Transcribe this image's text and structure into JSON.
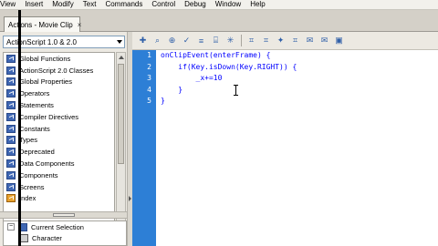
{
  "menubar": {
    "items": [
      "View",
      "Insert",
      "Modify",
      "Text",
      "Commands",
      "Control",
      "Debug",
      "Window",
      "Help"
    ]
  },
  "tab": {
    "label": "Actions - Movie Clip",
    "close": "×"
  },
  "language_select": {
    "value": "ActionScript 1.0 & 2.0"
  },
  "toolbox": {
    "items": [
      "Global Functions",
      "ActionScript 2.0 Classes",
      "Global Properties",
      "Operators",
      "Statements",
      "Compiler Directives",
      "Constants",
      "Types",
      "Deprecated",
      "Data Components",
      "Components",
      "Screens",
      "Index"
    ]
  },
  "script_navigator": {
    "expander": "−",
    "current_selection": "Current Selection",
    "character": "Character"
  },
  "editor": {
    "line_numbers": [
      "1",
      "2",
      "3",
      "4",
      "5"
    ],
    "code_lines": [
      "onClipEvent(enterFrame) {",
      "    if(Key.isDown(Key.RIGHT)) {",
      "        _x+=10",
      "    }",
      "}"
    ]
  },
  "colors": {
    "gutter": "#2d7fd6",
    "code": "#0000ff",
    "panel_bg": "#ece9e2"
  }
}
